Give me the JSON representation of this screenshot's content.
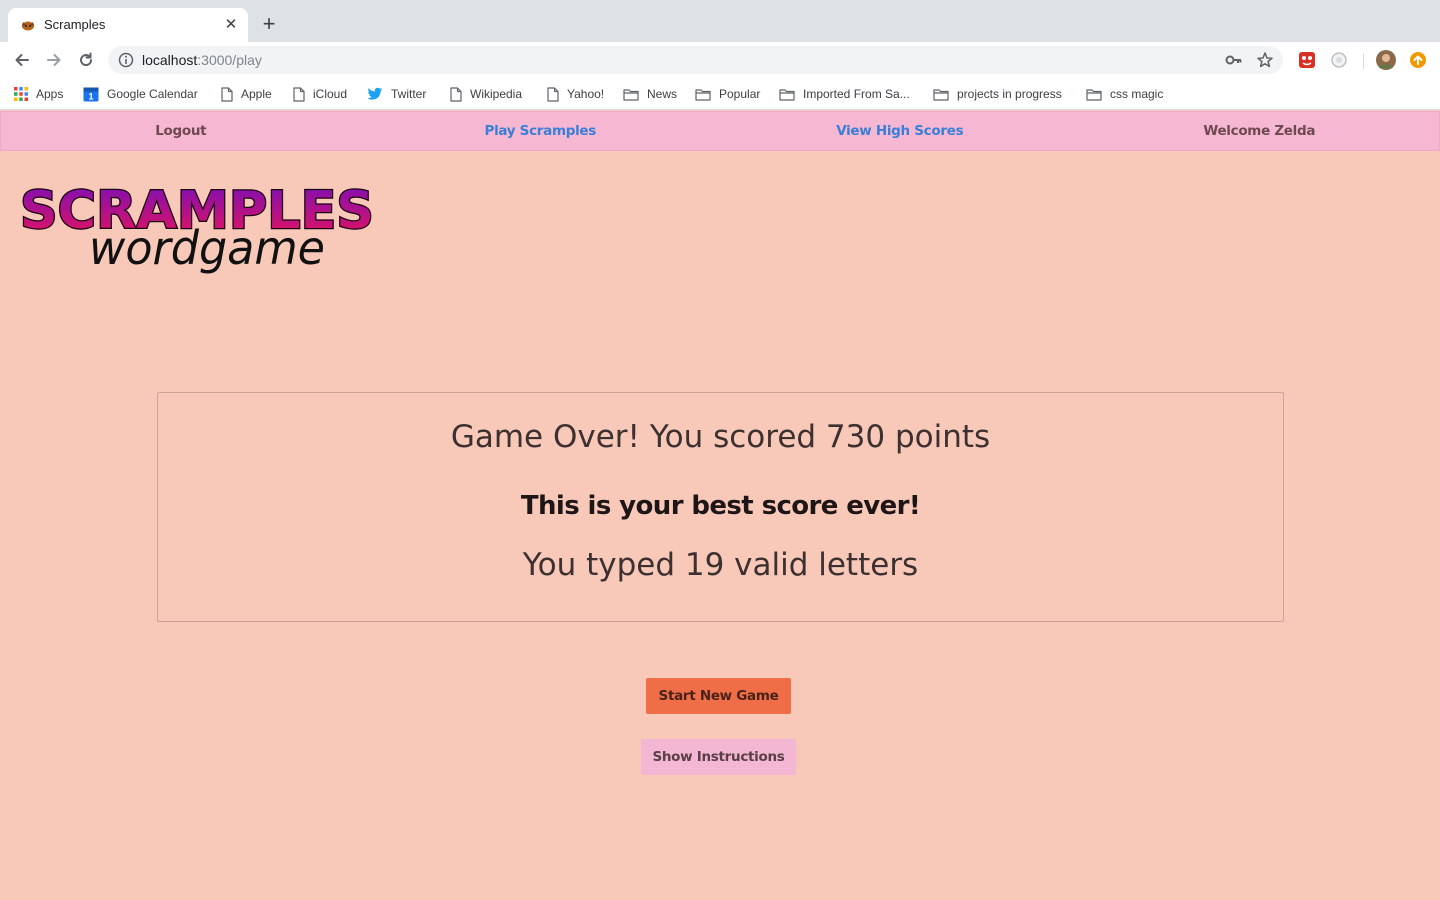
{
  "browser": {
    "tab": {
      "title": "Scramples",
      "favicon": "scramples-favicon-icon",
      "close_icon": "close-icon"
    },
    "new_tab_icon": "plus-icon",
    "nav": {
      "back_icon": "back-arrow-icon",
      "forward_icon": "forward-arrow-icon",
      "reload_icon": "reload-icon"
    },
    "address": {
      "host": "localhost",
      "path": ":3000/play"
    },
    "omnibox_icons": [
      "info-icon",
      "key-icon",
      "star-icon"
    ],
    "bookmarks": [
      {
        "label": "Apps",
        "icon": "apps-grid-icon"
      },
      {
        "label": "Google Calendar",
        "icon": "calendar-icon"
      },
      {
        "label": "Apple",
        "icon": "page-icon"
      },
      {
        "label": "iCloud",
        "icon": "page-icon"
      },
      {
        "label": "Twitter",
        "icon": "twitter-icon"
      },
      {
        "label": "Wikipedia",
        "icon": "page-icon"
      },
      {
        "label": "Yahoo!",
        "icon": "page-icon"
      },
      {
        "label": "News",
        "icon": "folder-icon"
      },
      {
        "label": "Popular",
        "icon": "folder-icon"
      },
      {
        "label": "Imported From Sa...",
        "icon": "folder-icon"
      },
      {
        "label": "projects in progress",
        "icon": "folder-icon"
      },
      {
        "label": "css magic",
        "icon": "folder-icon"
      }
    ]
  },
  "app_nav": {
    "logout": "Logout",
    "play": "Play Scramples",
    "high_scores": "View High Scores",
    "welcome": "Welcome Zelda"
  },
  "logo": {
    "title": "SCRAMPLES",
    "subtitle": "wordgame"
  },
  "result": {
    "score_text": "Game Over! You scored 730 points",
    "best_text": "This is your best score ever!",
    "letters_text": "You typed 19 valid letters"
  },
  "buttons": {
    "start_new_game": "Start New Game",
    "show_instructions": "Show Instructions"
  },
  "colors": {
    "page_bg": "#f8c9b9",
    "nav_bg": "#f6b7d3",
    "nav_link": "#3a7fd6",
    "start_button": "#ef6e48",
    "instructions_button": "#f4b7d3",
    "logo_gradient_start": "#7a0fb8",
    "logo_gradient_end": "#e8145a"
  }
}
